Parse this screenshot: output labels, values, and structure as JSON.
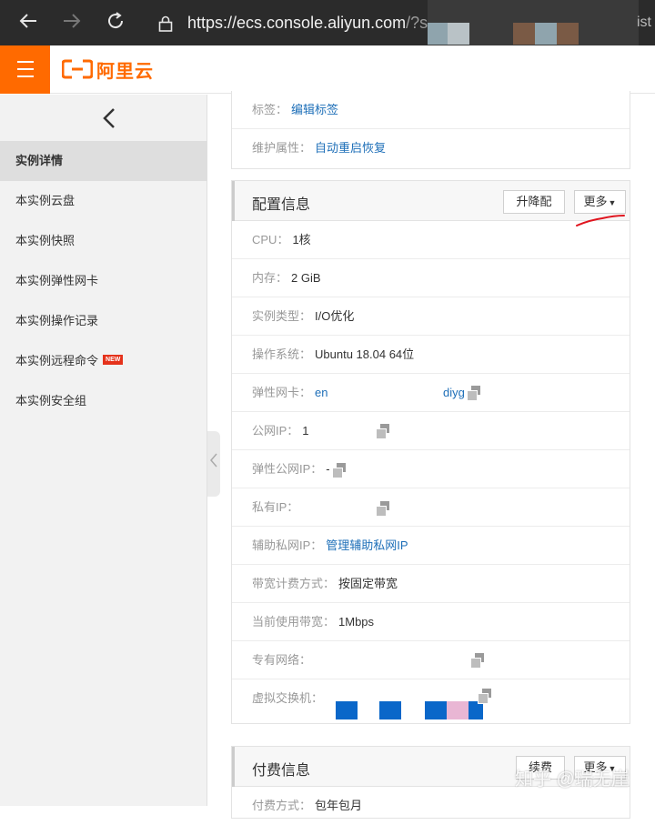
{
  "browser": {
    "url_main": "https://ecs.console.aliyun.com",
    "url_rest": "/?sp",
    "url_tail": "ist",
    "back_icon": "arrow-left-icon",
    "forward_icon": "arrow-right-icon",
    "reload_icon": "reload-icon"
  },
  "header": {
    "menu_icon": "hamburger-icon",
    "logo_text": "阿里云",
    "brand_color": "#ff6a00"
  },
  "sidebar": {
    "back_icon": "chevron-left-icon",
    "items": [
      {
        "label": "实例详情"
      },
      {
        "label": "本实例云盘"
      },
      {
        "label": "本实例快照"
      },
      {
        "label": "本实例弹性网卡"
      },
      {
        "label": "本实例操作记录"
      },
      {
        "label": "本实例远程命令",
        "badge": "NEW"
      },
      {
        "label": "本实例安全组"
      }
    ]
  },
  "basic": {
    "tags_label": "标签：",
    "tags_link": "编辑标签",
    "maintenance_label": "维护属性：",
    "maintenance_link": "自动重启恢复"
  },
  "config": {
    "title": "配置信息",
    "btn_downgrade": "升降配",
    "btn_more": "更多",
    "rows": {
      "cpu_label": "CPU：",
      "cpu_value": "1核",
      "mem_label": "内存：",
      "mem_value": "2 GiB",
      "type_label": "实例类型：",
      "type_value": "I/O优化",
      "os_label": "操作系统：",
      "os_value": "Ubuntu 18.04 64位",
      "eni_label": "弹性网卡：",
      "eni_value_start": "en",
      "eni_value_end": "diyg",
      "pubip_label": "公网IP：",
      "pubip_value": "1",
      "eip_label": "弹性公网IP：",
      "eip_value": "-",
      "privip_label": "私有IP：",
      "privip_value": "",
      "secip_label": "辅助私网IP：",
      "secip_link": "管理辅助私网IP",
      "billing_label": "带宽计费方式：",
      "billing_value": "按固定带宽",
      "bw_label": "当前使用带宽：",
      "bw_value": "1Mbps",
      "vpc_label": "专有网络：",
      "vpc_value": "",
      "vsw_label": "虚拟交换机：",
      "vsw_value": ""
    }
  },
  "payment": {
    "title": "付费信息",
    "btn_renew": "续费",
    "btn_more": "更多",
    "method_label": "付费方式：",
    "method_value": "包年包月"
  },
  "watermark": "知乎 @瑞无崖",
  "colors": {
    "link": "#1e6fb8",
    "annotation": "#e0141e",
    "redact_blue": "#0a67c9",
    "redact_pink": "#e9b6d4"
  }
}
